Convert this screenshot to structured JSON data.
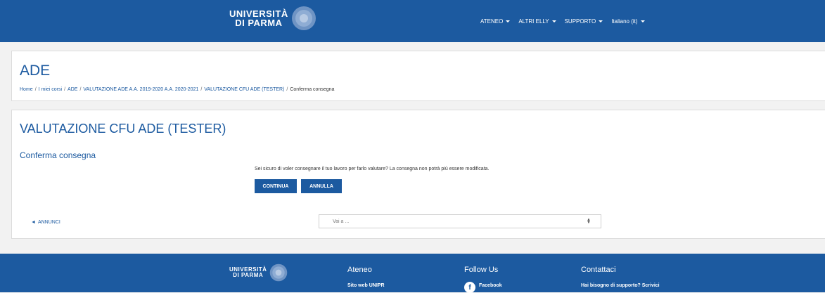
{
  "header": {
    "logo_line1": "UNIVERSITÀ",
    "logo_line2": "DI PARMA",
    "menu": [
      {
        "label": "ATENEO"
      },
      {
        "label": "ALTRI ELLY"
      },
      {
        "label": "SUPPORTO"
      },
      {
        "label": "Italiano (it)"
      }
    ]
  },
  "course": {
    "title": "ADE",
    "breadcrumb": [
      "Home",
      "I miei corsi",
      "ADE",
      "VALUTAZIONE ADE A.A. 2019-2020 A.A. 2020-2021",
      "VALUTAZIONE CFU ADE (TESTER)",
      "Conferma consegna"
    ]
  },
  "main": {
    "activity_title": "VALUTAZIONE CFU ADE (TESTER)",
    "section_title": "Conferma consegna",
    "message": "Sei sicuro di voler consegnare il tuo lavoro per farlo valutare? La consegna non potrà più essere modificata.",
    "continue_label": "CONTINUA",
    "cancel_label": "ANNULLA",
    "prev_link": "ANNUNCI",
    "jump_select": "Vai a ..."
  },
  "footer": {
    "logo_line1": "UNIVERSITÀ",
    "logo_line2": "DI PARMA",
    "col1_title": "Ateneo",
    "col1_link": "Sito web UNIPR",
    "col2_title": "Follow Us",
    "col2_link": "Facebook",
    "col3_title": "Contattaci",
    "col3_link": "Hai bisogno di supporto? Scrivici"
  },
  "colors": {
    "brand": "#1c5aa0",
    "background": "#f2f2f2"
  }
}
